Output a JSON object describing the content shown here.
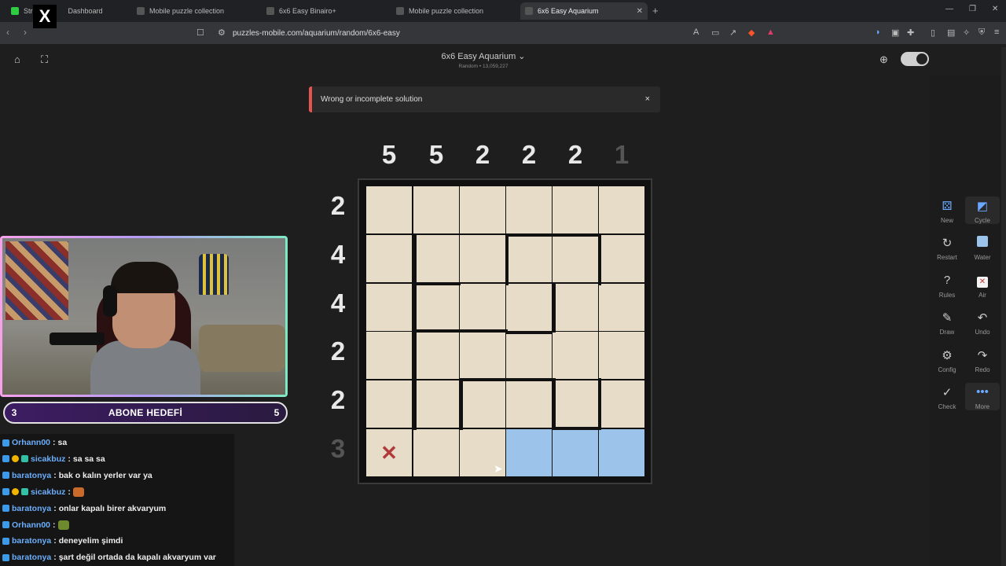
{
  "browser": {
    "tabs": [
      {
        "label": "Stre",
        "label2": "Dashboard"
      },
      {
        "label": "Mobile puzzle collection"
      },
      {
        "label": "6x6 Easy Binairo+"
      },
      {
        "label": "Mobile puzzle collection"
      },
      {
        "label": "6x6 Easy Aquarium",
        "active": true
      }
    ],
    "url": "puzzles-mobile.com/aquarium/random/6x6-easy"
  },
  "header": {
    "title": "6x6 Easy Aquarium ⌄",
    "subtitle": "Random • 13,059,227"
  },
  "banner": {
    "message": "Wrong or incomplete solution",
    "close": "×"
  },
  "puzzle": {
    "column_clues": [
      "5",
      "5",
      "2",
      "2",
      "2",
      "1"
    ],
    "row_clues": [
      "2",
      "4",
      "4",
      "2",
      "2",
      "3"
    ],
    "cells": [
      [
        "",
        "",
        "",
        "",
        "",
        ""
      ],
      [
        "",
        "",
        "",
        "",
        "",
        ""
      ],
      [
        "",
        "",
        "",
        "",
        "",
        ""
      ],
      [
        "",
        "",
        "",
        "",
        "",
        ""
      ],
      [
        "",
        "",
        "",
        "",
        "",
        ""
      ],
      [
        "air",
        "",
        "",
        "water",
        "water",
        "water"
      ]
    ],
    "air_symbol": "✕"
  },
  "toolbar": {
    "new": "New",
    "cycle": "Cycle",
    "restart": "Restart",
    "water": "Water",
    "rules": "Rules",
    "air": "Air",
    "draw": "Draw",
    "undo": "Undo",
    "config": "Config",
    "redo": "Redo",
    "check": "Check",
    "more": "More"
  },
  "stream": {
    "goal_current": "3",
    "goal_label": "ABONE HEDEFİ",
    "goal_target": "5",
    "chat": [
      {
        "user": "Orhann00",
        "text": "sa",
        "badges": [
          "blue"
        ]
      },
      {
        "user": "sicakbuz",
        "text": "sa sa sa",
        "badges": [
          "blue",
          "yellow",
          "teal"
        ]
      },
      {
        "user": "baratonya",
        "text": "bak o kalın yerler var ya",
        "badges": [
          "blue"
        ]
      },
      {
        "user": "sicakbuz",
        "text": "",
        "badges": [
          "blue",
          "yellow",
          "teal"
        ],
        "emote": "orange"
      },
      {
        "user": "baratonya",
        "text": "onlar kapalı birer akvaryum",
        "badges": [
          "blue"
        ]
      },
      {
        "user": "Orhann00",
        "text": "",
        "badges": [
          "blue"
        ],
        "emote": "green"
      },
      {
        "user": "baratonya",
        "text": "deneyelim şimdi",
        "badges": [
          "blue"
        ]
      },
      {
        "user": "baratonya",
        "text": "şart değil ortada da kapalı akvaryum var",
        "badges": [
          "blue"
        ]
      }
    ]
  },
  "colors": {
    "cell": "#e6dcc8",
    "water": "#9cc3ea",
    "error_accent": "#e55353"
  }
}
